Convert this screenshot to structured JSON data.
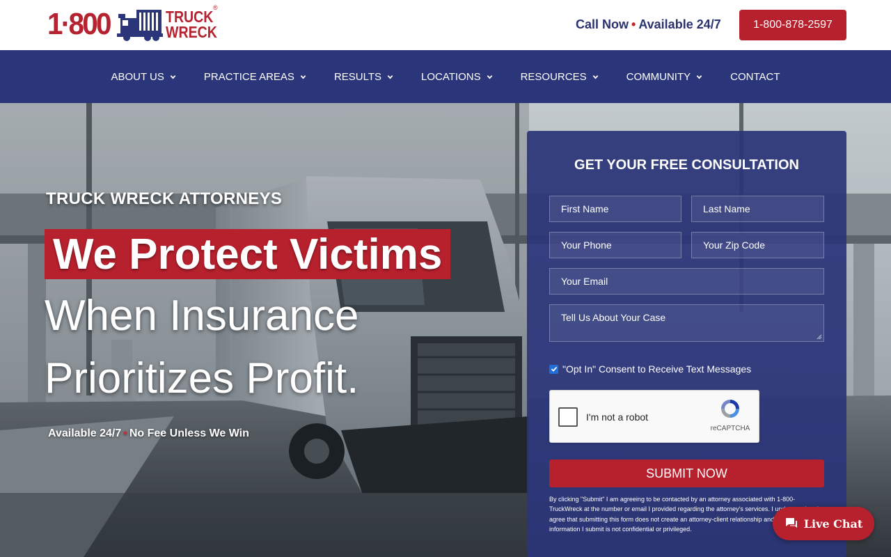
{
  "brand": {
    "logo_number": "1·800",
    "logo_word1": "TRUCK",
    "logo_word2": "WRECK",
    "logo_reg": "®",
    "accent_color": "#b7202d",
    "navy_color": "#2b3579"
  },
  "header": {
    "call_now": "Call Now",
    "available": "Available 24/7",
    "phone_label": "1-800-878-2597"
  },
  "nav": {
    "items": [
      {
        "label": "ABOUT US",
        "has_dropdown": true
      },
      {
        "label": "PRACTICE AREAS",
        "has_dropdown": true
      },
      {
        "label": "RESULTS",
        "has_dropdown": true
      },
      {
        "label": "LOCATIONS",
        "has_dropdown": true
      },
      {
        "label": "RESOURCES",
        "has_dropdown": true
      },
      {
        "label": "COMMUNITY",
        "has_dropdown": true
      },
      {
        "label": "CONTACT",
        "has_dropdown": false
      }
    ]
  },
  "hero": {
    "eyebrow": "TRUCK WRECK ATTORNEYS",
    "highlight": "We Protect Victims",
    "line2": "When Insurance",
    "line3": "Prioritizes Profit.",
    "sub_left": "Available 24/7",
    "sub_right": "No Fee Unless We Win",
    "background_image": "wrecked-semi-truck-on-highway"
  },
  "form": {
    "title": "GET YOUR FREE CONSULTATION",
    "first_name_placeholder": "First Name",
    "last_name_placeholder": "Last Name",
    "phone_placeholder": "Your Phone",
    "zip_placeholder": "Your Zip Code",
    "email_placeholder": "Your Email",
    "case_placeholder": "Tell Us About Your Case",
    "optin_checked": true,
    "optin_label": "\"Opt In\" Consent to Receive Text Messages",
    "captcha_label": "I'm not a robot",
    "captcha_brand": "reCAPTCHA",
    "submit_label": "SUBMIT NOW",
    "disclaimer": "By clicking \"Submit\" I am agreeing to be contacted by an attorney associated with 1-800-TruckWreck at the number or email I provided regarding the attorney's services. I understand and agree that submitting this form does not create an attorney-client relationship and that the information I submit is not confidential or privileged."
  },
  "chat": {
    "label": "Live Chat",
    "icon": "chat-bubble-icon"
  }
}
